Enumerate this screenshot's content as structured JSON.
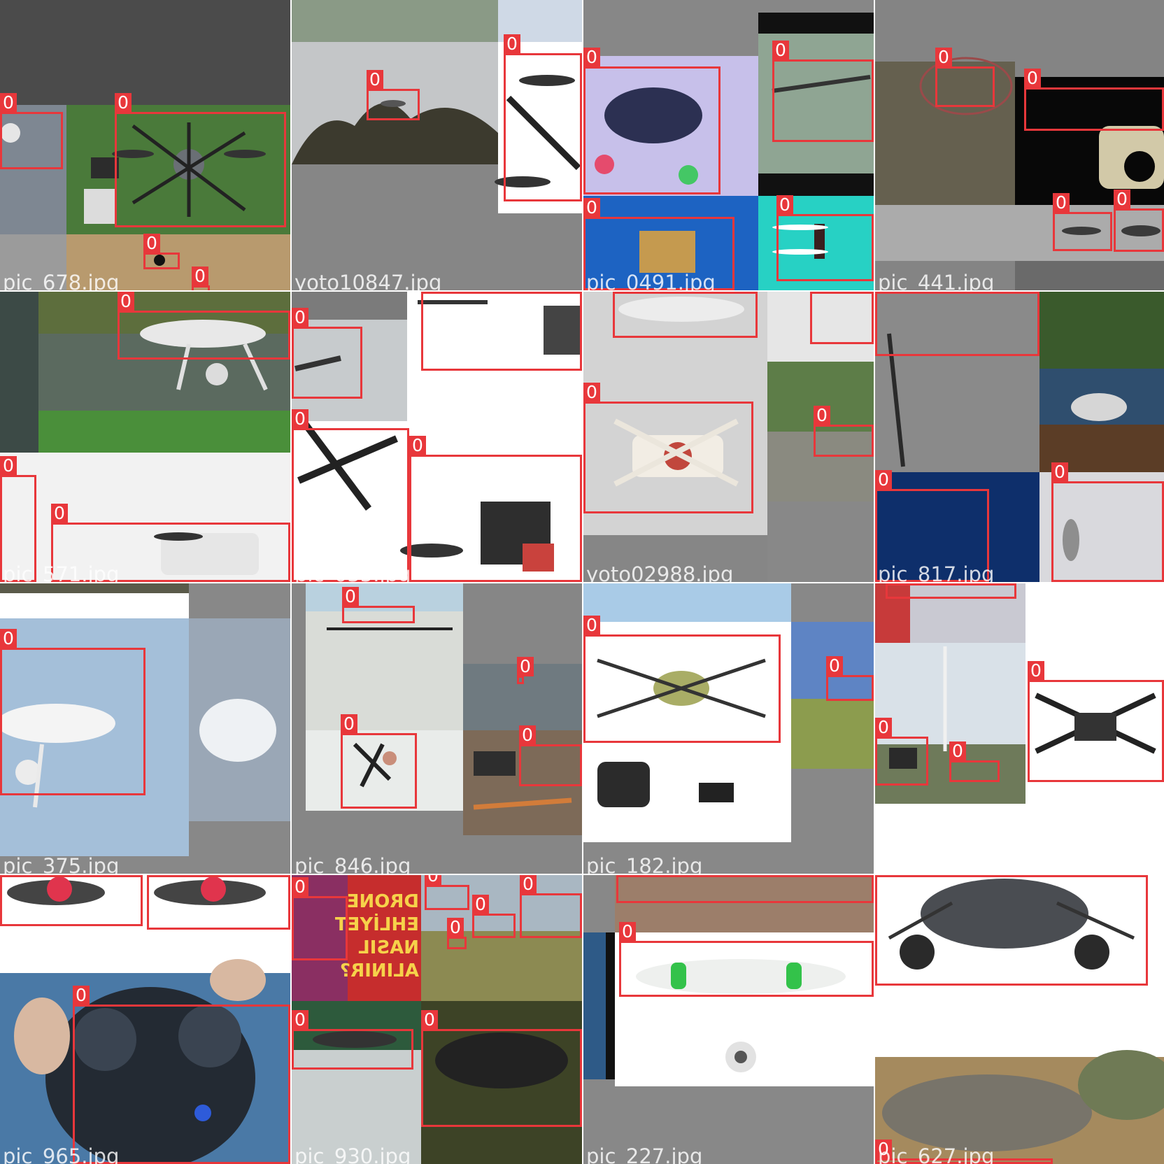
{
  "mosaic": {
    "label_color": "#e8373b",
    "tiles": [
      {
        "id": "t1",
        "filename": "pic_678.jpg",
        "bg": "#4a4a4a",
        "boxes": [
          {
            "class": "0"
          },
          {
            "class": "0"
          },
          {
            "class": "0"
          },
          {
            "class": "0"
          }
        ]
      },
      {
        "id": "t2",
        "filename": "yoto10847.jpg",
        "bg": "#868686",
        "boxes": [
          {
            "class": "0"
          },
          {
            "class": "0"
          }
        ]
      },
      {
        "id": "t3",
        "filename": "pic_0491.jpg",
        "bg": "#878787",
        "boxes": [
          {
            "class": "0"
          },
          {
            "class": "0"
          },
          {
            "class": "0"
          },
          {
            "class": "0"
          }
        ]
      },
      {
        "id": "t4",
        "filename": "pic_441.jpg",
        "bg": "#848484",
        "boxes": [
          {
            "class": "0"
          },
          {
            "class": "0"
          },
          {
            "class": "0"
          },
          {
            "class": "0"
          }
        ]
      },
      {
        "id": "t5",
        "filename": "pic_571.jpg",
        "bg": "#ffffff",
        "boxes": [
          {
            "class": "0"
          },
          {
            "class": "0"
          },
          {
            "class": "0"
          }
        ]
      },
      {
        "id": "t6",
        "filename": "pic_035.jpg",
        "bg": "#ffffff",
        "boxes": [
          {
            "class": "0"
          },
          {
            "class": "0"
          },
          {
            "class": "0"
          },
          {
            "class": "0"
          }
        ]
      },
      {
        "id": "t7",
        "filename": "yoto02988.jpg",
        "bg": "#868686",
        "boxes": [
          {
            "class": "0"
          },
          {
            "class": "0"
          },
          {
            "class": "0"
          },
          {
            "class": "0"
          }
        ]
      },
      {
        "id": "t8",
        "filename": "pic_817.jpg",
        "bg": "#848484",
        "boxes": [
          {
            "class": "0"
          },
          {
            "class": "0"
          },
          {
            "class": "0"
          }
        ]
      },
      {
        "id": "t9",
        "filename": "pic_375.jpg",
        "bg": "#888888",
        "boxes": [
          {
            "class": "0"
          }
        ]
      },
      {
        "id": "t10",
        "filename": "pic_846.jpg",
        "bg": "#868686",
        "boxes": [
          {
            "class": "0"
          },
          {
            "class": "0"
          },
          {
            "class": "0"
          },
          {
            "class": "0"
          }
        ]
      },
      {
        "id": "t11",
        "filename": "pic_182.jpg",
        "bg": "#888888",
        "boxes": [
          {
            "class": "0"
          },
          {
            "class": "0"
          }
        ]
      },
      {
        "id": "t12",
        "filename": "pic_618.jpg",
        "bg": "#ffffff",
        "boxes": [
          {
            "class": "0"
          },
          {
            "class": "0"
          },
          {
            "class": "0"
          },
          {
            "class": "0"
          }
        ]
      },
      {
        "id": "t13",
        "filename": "pic_965.jpg",
        "bg": "#ffffff",
        "boxes": [
          {
            "class": "0"
          },
          {
            "class": "0"
          },
          {
            "class": "0"
          }
        ]
      },
      {
        "id": "t14",
        "filename": "pic_930.jpg",
        "bg": "#ffffff",
        "sign_text": [
          "DRONE",
          "EHLİYET",
          "NASIL",
          "ALINIR?"
        ],
        "boxes": [
          {
            "class": "0"
          },
          {
            "class": "0"
          },
          {
            "class": "0"
          },
          {
            "class": "0"
          },
          {
            "class": "0"
          },
          {
            "class": "0"
          },
          {
            "class": "0"
          }
        ]
      },
      {
        "id": "t15",
        "filename": "pic_227.jpg",
        "bg": "#888888",
        "boxes": [
          {
            "class": "0"
          },
          {
            "class": "0"
          }
        ]
      },
      {
        "id": "t16",
        "filename": "pic_627.jpg",
        "bg": "#ffffff",
        "boxes": [
          {
            "class": "0"
          },
          {
            "class": "0"
          }
        ]
      }
    ]
  }
}
